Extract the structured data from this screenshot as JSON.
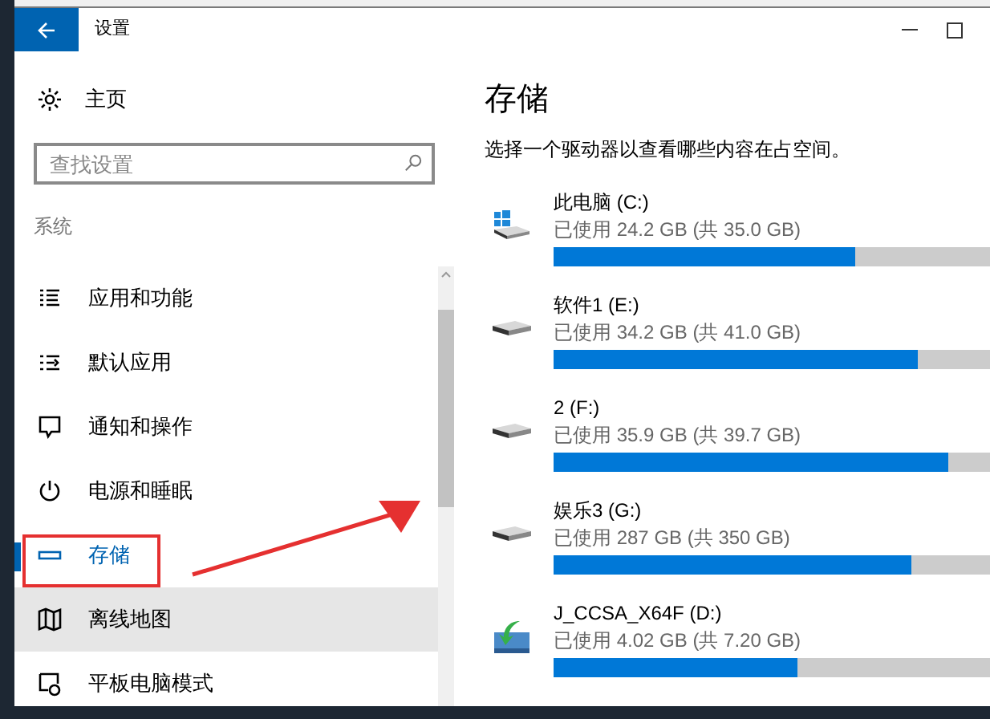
{
  "window": {
    "title": "设置"
  },
  "sidebar": {
    "home": "主页",
    "search": {
      "placeholder": "查找设置"
    },
    "section": "系统",
    "items": [
      {
        "label": "应用和功能",
        "selected": false,
        "hovered": false
      },
      {
        "label": "默认应用",
        "selected": false,
        "hovered": false
      },
      {
        "label": "通知和操作",
        "selected": false,
        "hovered": false
      },
      {
        "label": "电源和睡眠",
        "selected": false,
        "hovered": false
      },
      {
        "label": "存储",
        "selected": true,
        "hovered": false
      },
      {
        "label": "离线地图",
        "selected": false,
        "hovered": true
      },
      {
        "label": "平板电脑模式",
        "selected": false,
        "hovered": false
      }
    ]
  },
  "content": {
    "title": "存储",
    "subtitle": "选择一个驱动器以查看哪些内容在占空间。",
    "drives": [
      {
        "kind": "system",
        "name": "此电脑 (C:)",
        "usage": "已使用 24.2 GB (共 35.0 GB)",
        "level": 0.69
      },
      {
        "kind": "disk",
        "name": "软件1 (E:)",
        "usage": "已使用 34.2 GB (共 41.0 GB)",
        "level": 0.834
      },
      {
        "kind": "disk",
        "name": "2 (F:)",
        "usage": "已使用 35.9 GB (共 39.7 GB)",
        "level": 0.904
      },
      {
        "kind": "disk",
        "name": "娱乐3 (G:)",
        "usage": "已使用 287 GB (共 350 GB)",
        "level": 0.82
      },
      {
        "kind": "setup",
        "name": "J_CCSA_X64F (D:)",
        "usage": "已使用 4.02 GB (共 7.20 GB)",
        "level": 0.558
      }
    ]
  }
}
